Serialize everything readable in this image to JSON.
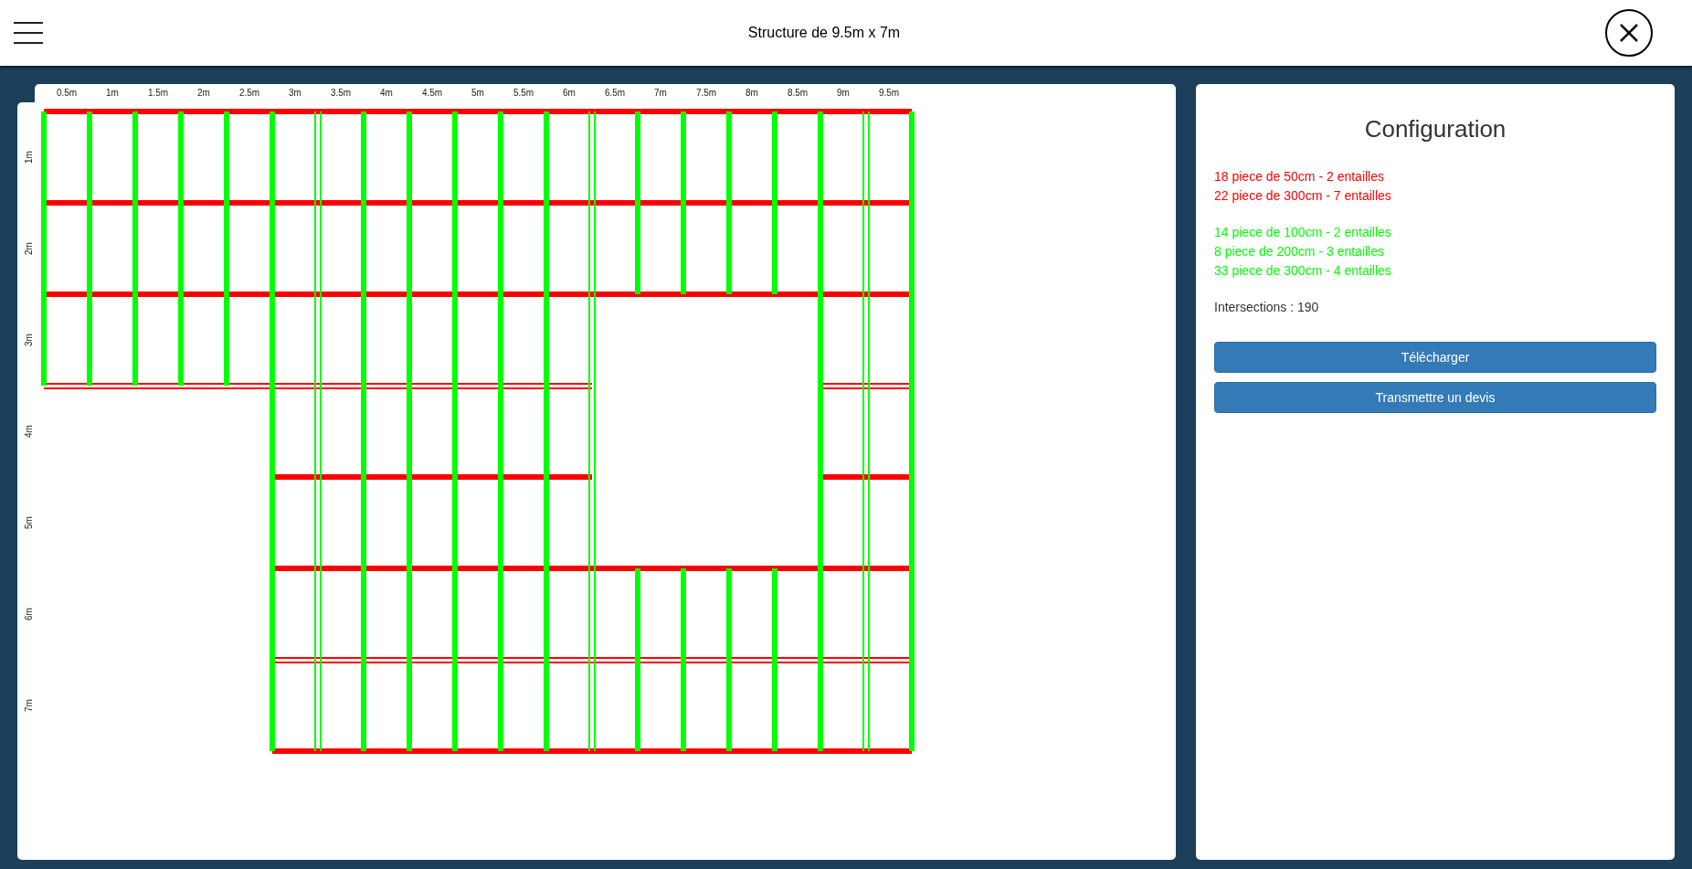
{
  "header": {
    "title": "Structure de 9.5m x 7m"
  },
  "ruler": {
    "x_labels": [
      "0.5m",
      "1m",
      "1.5m",
      "2m",
      "2.5m",
      "3m",
      "3.5m",
      "4m",
      "4.5m",
      "5m",
      "5.5m",
      "6m",
      "6.5m",
      "7m",
      "7.5m",
      "8m",
      "8.5m",
      "9m",
      "9.5m"
    ],
    "y_labels": [
      "1m",
      "2m",
      "3m",
      "4m",
      "5m",
      "6m",
      "7m"
    ]
  },
  "config": {
    "title": "Configuration",
    "groups": [
      {
        "color": "#ff0000",
        "lines": [
          "18 piece de 50cm - 2 entailles",
          "22 piece de 300cm - 7 entailles"
        ]
      },
      {
        "color": "#00ff00",
        "lines": [
          "14 piece de 100cm - 2 entailles",
          "8 piece de 200cm - 3 entailles",
          "33 piece de 300cm - 4 entailles"
        ]
      }
    ],
    "intersections": "Intersections : 190",
    "buttons": [
      "Télécharger",
      "Transmettre un devis"
    ]
  }
}
